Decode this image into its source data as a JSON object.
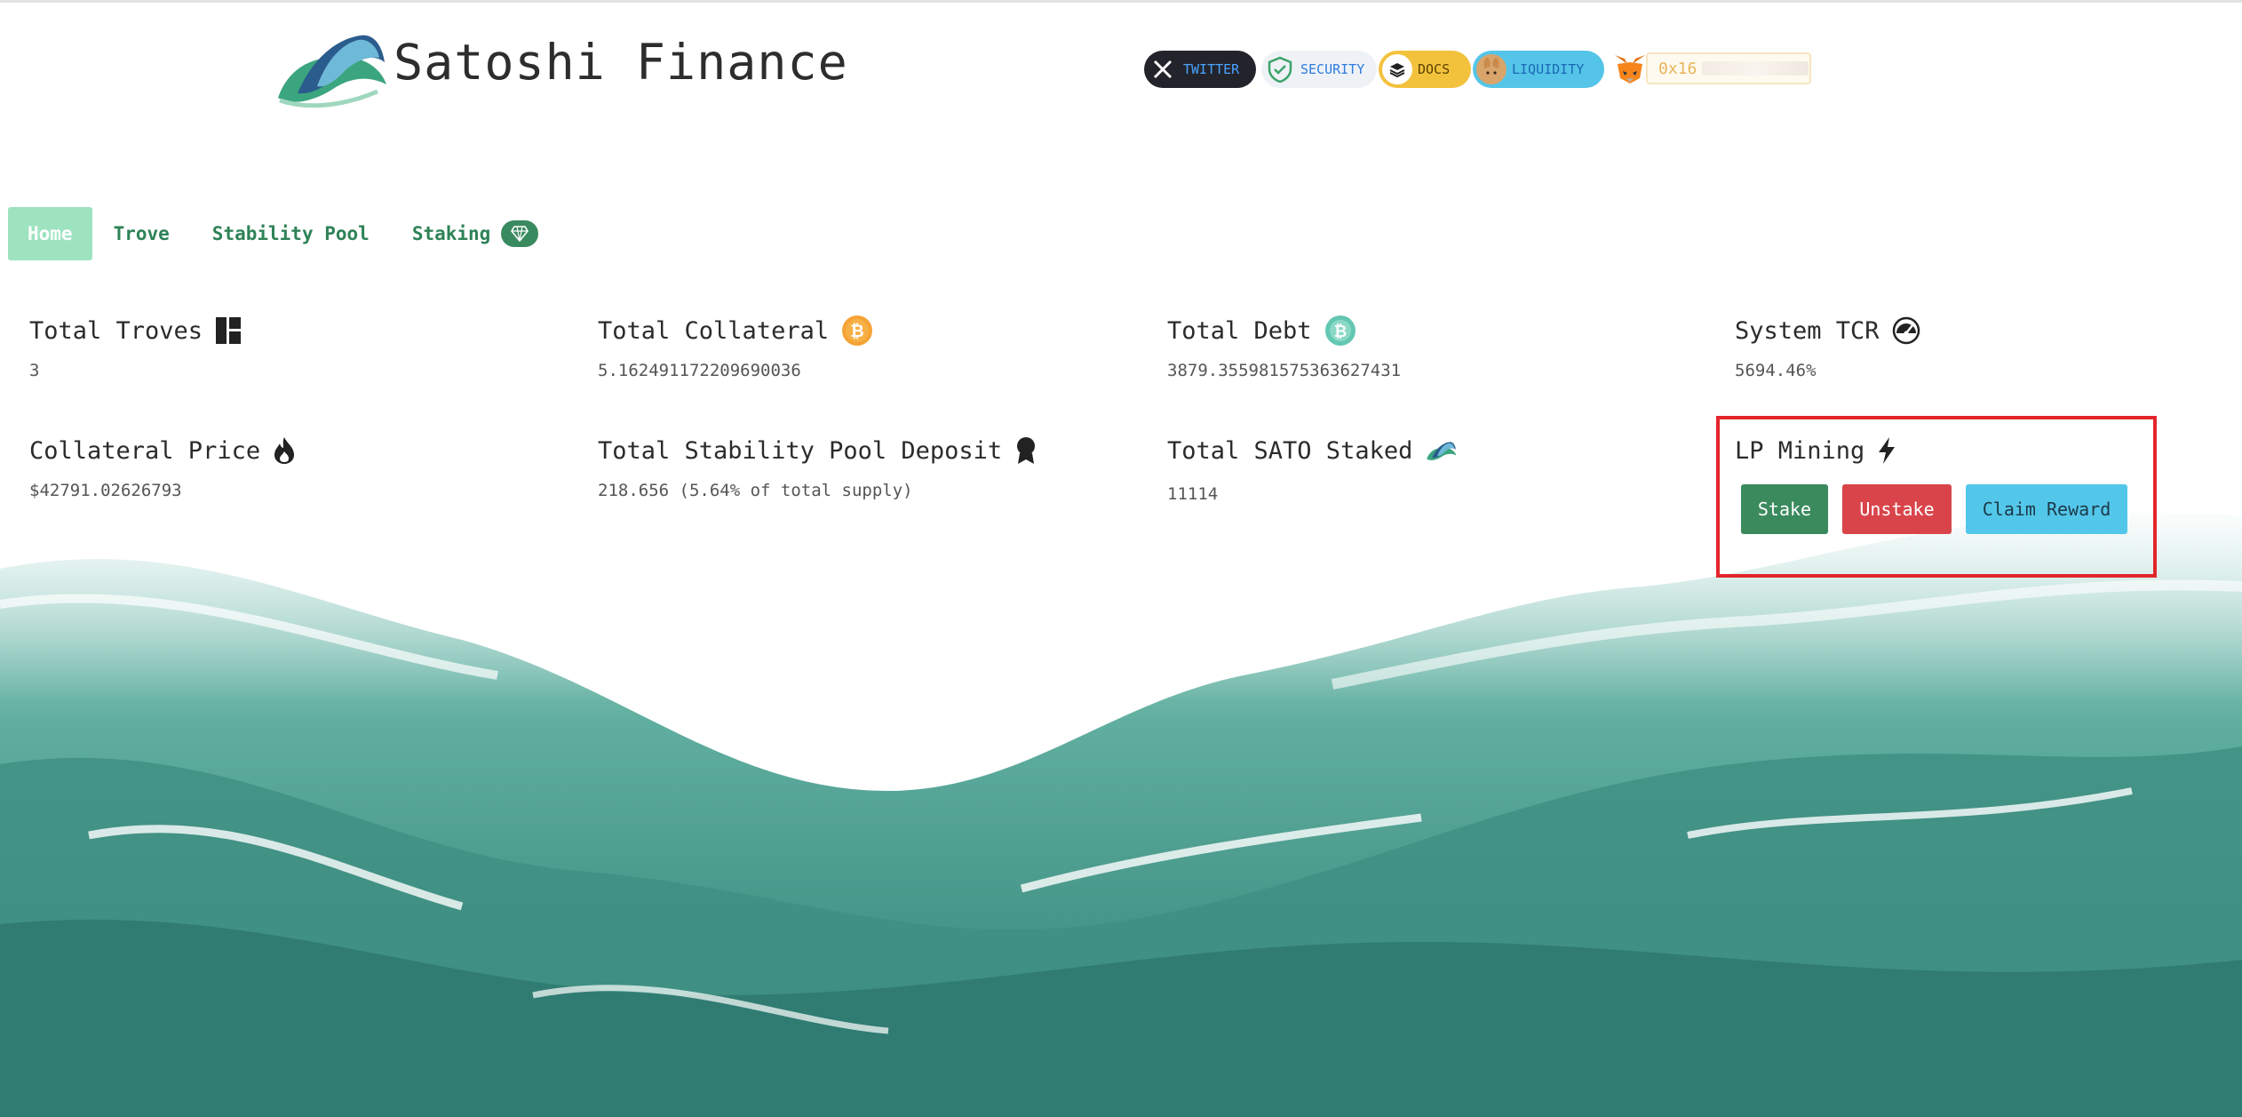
{
  "app": {
    "brand": "Satoshi Finance"
  },
  "header": {
    "links": [
      {
        "label": "TWITTER",
        "icon": "x-logo-icon"
      },
      {
        "label": "SECURITY",
        "icon": "shield-check-icon"
      },
      {
        "label": "DOCS",
        "icon": "gitbook-icon"
      },
      {
        "label": "LIQUIDITY",
        "icon": "pancakeswap-bunny-icon"
      }
    ],
    "wallet": {
      "icon": "metamask-fox-icon",
      "address_prefix": "0x16"
    }
  },
  "nav": {
    "items": [
      {
        "label": "Home",
        "active": true
      },
      {
        "label": "Trove",
        "active": false
      },
      {
        "label": "Stability Pool",
        "active": false
      },
      {
        "label": "Staking",
        "active": false,
        "badge_icon": "diamond-icon"
      }
    ]
  },
  "stats": {
    "total_troves": {
      "title": "Total Troves",
      "value": "3",
      "icon": "dashboard-grid-icon"
    },
    "total_collateral": {
      "title": "Total Collateral",
      "value": "5.162491172209690036",
      "icon": "bitcoin-icon"
    },
    "total_debt": {
      "title": "Total Debt",
      "value": "3879.355981575363627431",
      "icon": "sat-token-icon"
    },
    "system_tcr": {
      "title": "System TCR",
      "value": "5694.46%",
      "icon": "gauge-icon"
    },
    "collateral_price": {
      "title": "Collateral Price",
      "value": "$42791.02626793",
      "icon": "flame-icon"
    },
    "stability_pool": {
      "title": "Total Stability Pool Deposit",
      "value": "218.656 (5.64% of total supply)",
      "icon": "award-ribbon-icon"
    },
    "sato_staked": {
      "title": "Total SATO Staked",
      "value": "11114",
      "icon": "sato-logo-icon"
    },
    "lp_mining": {
      "title": "LP Mining",
      "icon": "lightning-bolt-icon",
      "stake_label": "Stake",
      "unstake_label": "Unstake",
      "claim_label": "Claim Reward"
    }
  },
  "colors": {
    "accent_green": "#3b8a5e",
    "nav_active_bg": "#9de3c0",
    "danger": "#d9444a",
    "info": "#53c7ea",
    "highlight_border": "#e3262b"
  }
}
